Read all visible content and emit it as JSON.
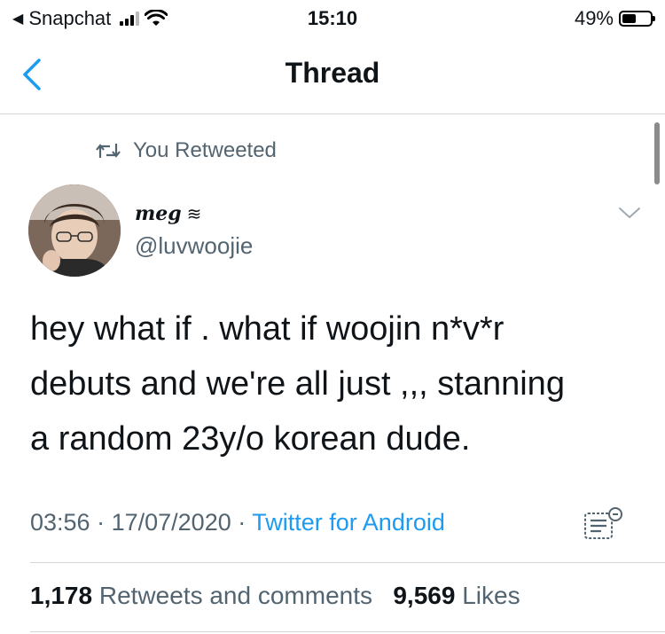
{
  "status_bar": {
    "back_app": "Snapchat",
    "time": "15:10",
    "battery": "49%",
    "battery_level": 0.49
  },
  "nav": {
    "title": "Thread"
  },
  "retweet_banner": {
    "label": "You Retweeted"
  },
  "author": {
    "display_name": "meg",
    "display_name_suffix": "≋",
    "handle": "@luvwoojie"
  },
  "tweet": {
    "text": "hey what if . what if woojin n*v*r\ndebuts and we're all just ,,, stanning\na random 23y/o korean dude.",
    "time": "03:56",
    "date": "17/07/2020",
    "source": "Twitter for Android"
  },
  "stats": {
    "retweets_count": "1,178",
    "retweets_label": "Retweets and comments",
    "likes_count": "9,569",
    "likes_label": "Likes"
  },
  "colors": {
    "accent": "#1d9bf0",
    "secondary_text": "#536471",
    "divider": "#d0d6da"
  },
  "icons": [
    "back-chevron-icon",
    "signal-icon",
    "wifi-icon",
    "battery-icon",
    "retweet-icon",
    "chevron-down-icon",
    "analytics-icon"
  ]
}
